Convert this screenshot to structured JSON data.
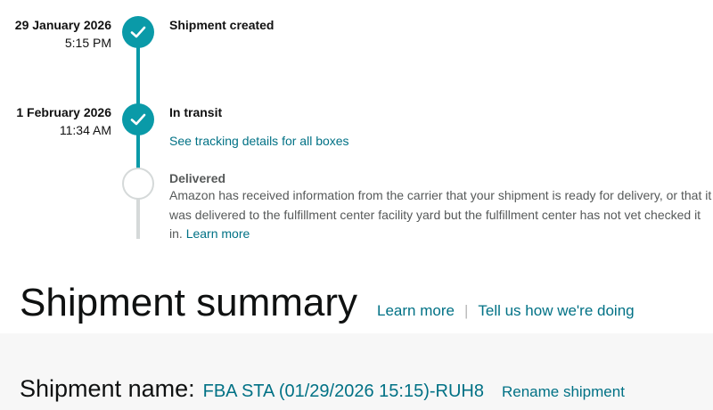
{
  "timeline": {
    "steps": [
      {
        "date": "29 January 2026",
        "time": "5:15 PM",
        "title": "Shipment created",
        "status": "complete"
      },
      {
        "date": "1 February 2026",
        "time": "11:34 AM",
        "title": "In transit",
        "status": "complete",
        "link": "See tracking details for all boxes"
      },
      {
        "title": "Delivered",
        "status": "pending",
        "description": "Amazon has received information from the carrier that your shipment is ready for delivery, or that it was delivered to the fulfillment center facility yard but the fulfillment center has not vet checked it in.",
        "link": "Learn more"
      }
    ]
  },
  "summary": {
    "title": "Shipment summary",
    "learn_more": "Learn more",
    "separator": "|",
    "feedback": "Tell us how we're doing"
  },
  "shipment": {
    "name_label": "Shipment name:",
    "name_value": "FBA STA (01/29/2026 15:15)-RUH8",
    "rename_label": "Rename shipment"
  },
  "colors": {
    "accent": "#0a9aa8",
    "link": "#007185",
    "muted_text": "#565959",
    "inactive_line": "#d5d9d9"
  },
  "icons": {
    "complete": "check-icon",
    "pending": "empty-circle-icon"
  }
}
